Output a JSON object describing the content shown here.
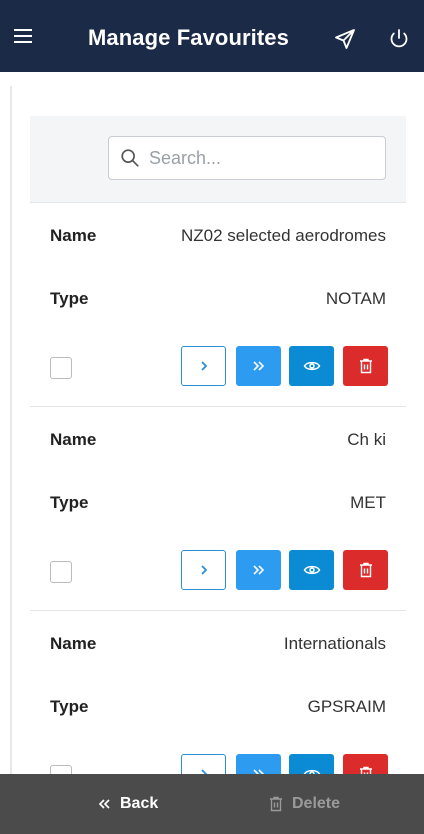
{
  "header": {
    "title": "Manage Favourites",
    "menu_icon": "menu-icon",
    "send_icon": "send-icon",
    "power_icon": "power-icon",
    "background": "#1b2a47"
  },
  "search": {
    "placeholder": "Search...",
    "value": ""
  },
  "labels": {
    "name": "Name",
    "type": "Type"
  },
  "favourites": [
    {
      "name": "NZ02 selected aerodromes",
      "type": "NOTAM"
    },
    {
      "name": "Ch ki",
      "type": "MET"
    },
    {
      "name": "Internationals",
      "type": "GPSRAIM"
    }
  ],
  "actions": {
    "icons": [
      "chevron-right-icon",
      "double-chevron-right-icon",
      "eye-icon",
      "trash-icon"
    ],
    "colors": {
      "outline": "#2b8fd8",
      "blue": "#2d9cf0",
      "dark_blue": "#0b8bd4",
      "red": "#dc2b2b"
    }
  },
  "footer": {
    "back_label": "Back",
    "delete_label": "Delete",
    "background": "#4b4b4b"
  }
}
